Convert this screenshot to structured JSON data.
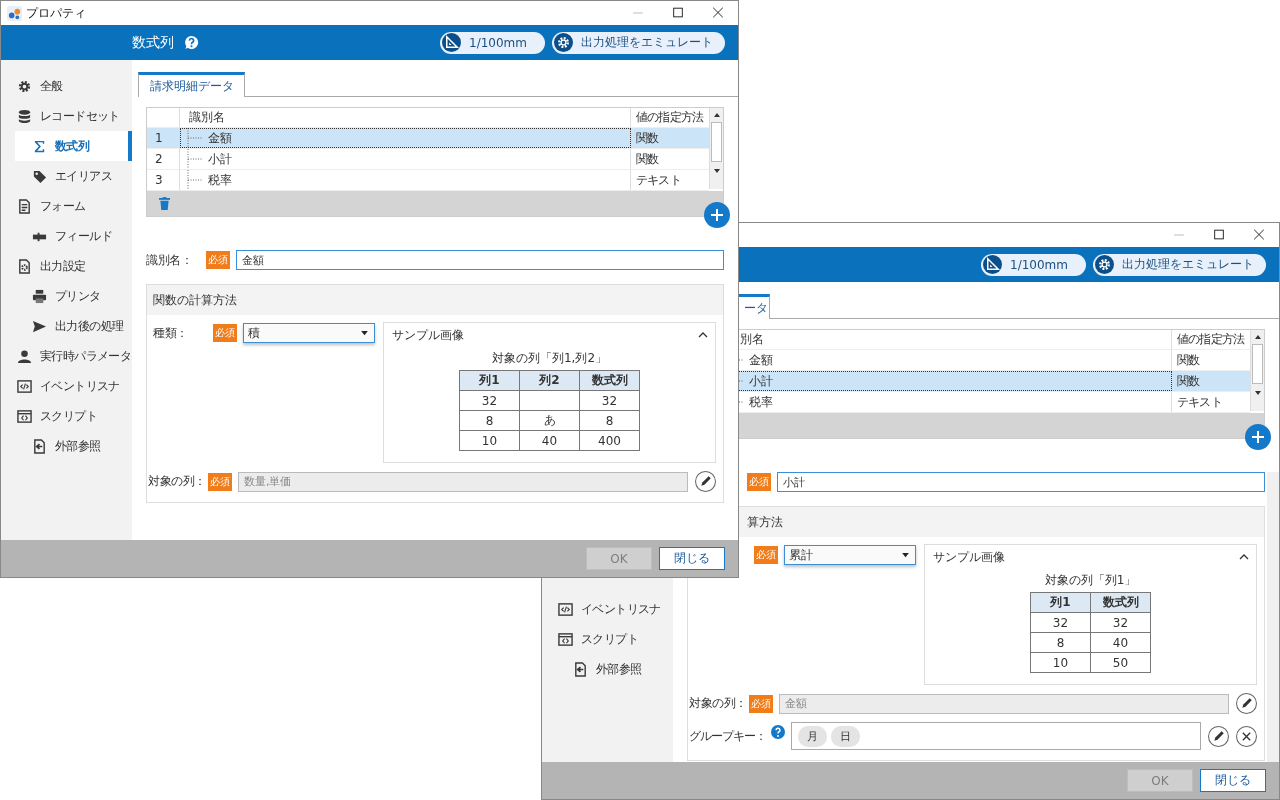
{
  "windows": [
    {
      "title": "プロパティ",
      "heading": "数式列",
      "unit_button": "1/100mm",
      "emulate_button": "出力処理をエミュレート",
      "sidebar": [
        {
          "label": "全般",
          "selected": false
        },
        {
          "label": "レコードセット",
          "selected": false,
          "children": [
            {
              "label": "数式列",
              "selected": true
            },
            {
              "label": "エイリアス",
              "selected": false
            }
          ]
        },
        {
          "label": "フォーム",
          "selected": false,
          "children": [
            {
              "label": "フィールド",
              "selected": false
            }
          ]
        },
        {
          "label": "出力設定",
          "selected": false,
          "children": [
            {
              "label": "プリンタ",
              "selected": false
            },
            {
              "label": "出力後の処理",
              "selected": false
            }
          ]
        },
        {
          "label": "実行時パラメータ",
          "selected": false
        },
        {
          "label": "イベントリスナ",
          "selected": false
        },
        {
          "label": "スクリプト",
          "selected": false,
          "children": [
            {
              "label": "外部参照",
              "selected": false
            }
          ]
        }
      ],
      "tab": {
        "label": "請求明細データ",
        "selected": true
      },
      "table": {
        "columns": [
          "識別名",
          "値の指定方法"
        ],
        "rows": [
          {
            "number": "1",
            "name": "金額",
            "method": "関数",
            "selected": true
          },
          {
            "number": "2",
            "name": "小計",
            "method": "関数",
            "selected": false
          },
          {
            "number": "3",
            "name": "税率",
            "method": "テキスト",
            "selected": false
          }
        ]
      },
      "name_field": {
        "label": "識別名：",
        "required": "必須",
        "value": "金額"
      },
      "section": {
        "title": "関数の計算方法",
        "kind_field": {
          "label": "種類：",
          "required": "必須",
          "value": "積"
        },
        "sample": {
          "title": "サンプル画像",
          "expanded": true,
          "caption": "対象の列「列1,列2」",
          "columns": [
            "列1",
            "列2",
            "数式列"
          ],
          "rows": [
            [
              "32",
              null,
              "32"
            ],
            [
              "8",
              "あ",
              "8"
            ],
            [
              "10",
              "40",
              "400"
            ]
          ]
        },
        "target_field": {
          "label": "対象の列：",
          "required": "必須",
          "value": "数量,単価",
          "disabled": true
        }
      },
      "buttons": {
        "ok": {
          "label": "OK",
          "disabled": true
        },
        "close": {
          "label": "閉じる",
          "disabled": false
        }
      }
    },
    {
      "unit_button": "1/100mm",
      "emulate_button": "出力処理をエミュレート",
      "sidebar": [
        {
          "label": "イベントリスナ",
          "selected": false
        },
        {
          "label": "スクリプト",
          "selected": false,
          "children": [
            {
              "label": "外部参照",
              "selected": false
            }
          ]
        }
      ],
      "tab": {
        "label": "ータ",
        "selected": true
      },
      "table": {
        "columns": [
          "別名",
          "値の指定方法"
        ],
        "rows": [
          {
            "name": "金額",
            "method": "関数",
            "selected": false
          },
          {
            "name": "小計",
            "method": "関数",
            "selected": true
          },
          {
            "name": "税率",
            "method": "テキスト",
            "selected": false
          }
        ]
      },
      "name_field": {
        "required": "必須",
        "value": "小計"
      },
      "section": {
        "title": "算方法",
        "kind_field": {
          "required": "必須",
          "value": "累計"
        },
        "sample": {
          "title": "サンプル画像",
          "expanded": true,
          "caption": "対象の列「列1」",
          "columns": [
            "列1",
            "数式列"
          ],
          "rows": [
            [
              "32",
              "32"
            ],
            [
              "8",
              "40"
            ],
            [
              "10",
              "50"
            ]
          ]
        },
        "target_field": {
          "label": "対象の列：",
          "required": "必須",
          "value": "金額",
          "disabled": true
        },
        "group_key": {
          "label": "グループキー：",
          "chips": [
            "月",
            "日"
          ]
        }
      },
      "buttons": {
        "ok": {
          "label": "OK",
          "disabled": true
        },
        "close": {
          "label": "閉じる",
          "disabled": false
        }
      }
    }
  ]
}
